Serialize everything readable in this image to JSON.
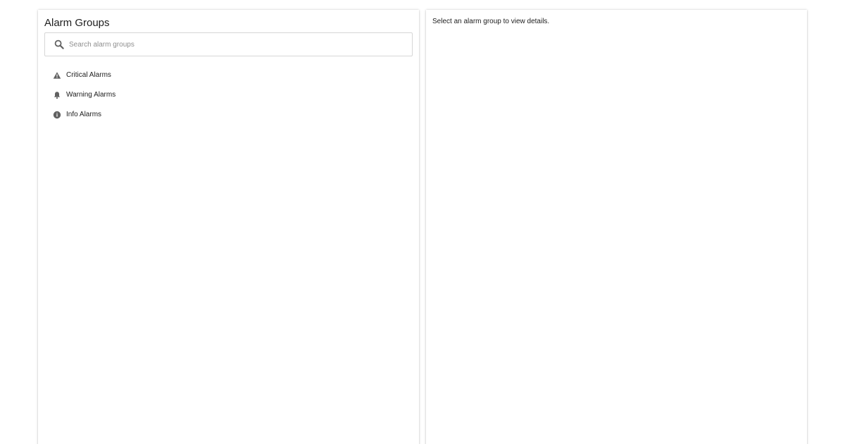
{
  "sidebar": {
    "title": "Alarm Groups",
    "search": {
      "placeholder": "Search alarm groups",
      "value": "",
      "icon": "search-icon"
    },
    "items": [
      {
        "label": "Critical Alarms",
        "icon": "warning-triangle-icon"
      },
      {
        "label": "Warning Alarms",
        "icon": "bell-icon"
      },
      {
        "label": "Info Alarms",
        "icon": "info-circle-icon"
      }
    ]
  },
  "detail": {
    "message": "Select an alarm group to view details."
  },
  "colors": {
    "icon": "#616161",
    "text": "#202020",
    "placeholder": "#8f8f8f",
    "border": "#d6d6d6"
  }
}
